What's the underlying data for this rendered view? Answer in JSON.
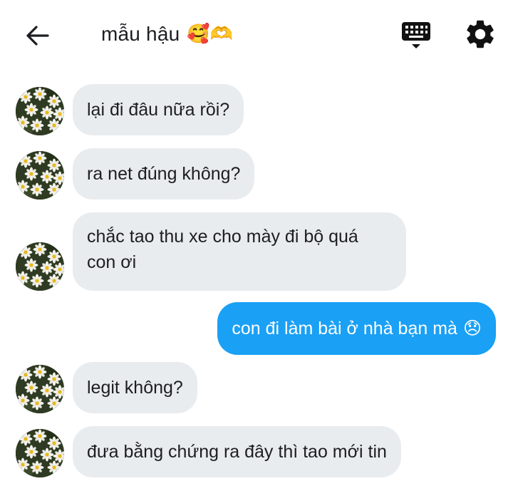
{
  "header": {
    "title": "mẫu hậu",
    "title_emoji": "🥰🫶",
    "back_icon": "arrow-left-icon",
    "keyboard_icon": "keyboard-icon",
    "settings_icon": "gear-icon"
  },
  "messages": [
    {
      "from": "them",
      "text": "lại đi đâu nữa rồi?"
    },
    {
      "from": "them",
      "text": "ra net đúng không?"
    },
    {
      "from": "them",
      "line1": "chắc tao thu xe cho mày đi bộ quá",
      "line2": "con ơi"
    },
    {
      "from": "me",
      "text": "con đi làm bài ở nhà bạn mà",
      "emoji": "😞"
    },
    {
      "from": "them",
      "text": "legit không?"
    },
    {
      "from": "them",
      "text": "đưa bằng chứng ra đây thì tao mới tin"
    }
  ],
  "colors": {
    "incoming_bubble": "#e9ecef",
    "outgoing_bubble": "#1aa0f5",
    "text": "#1c1e21"
  }
}
